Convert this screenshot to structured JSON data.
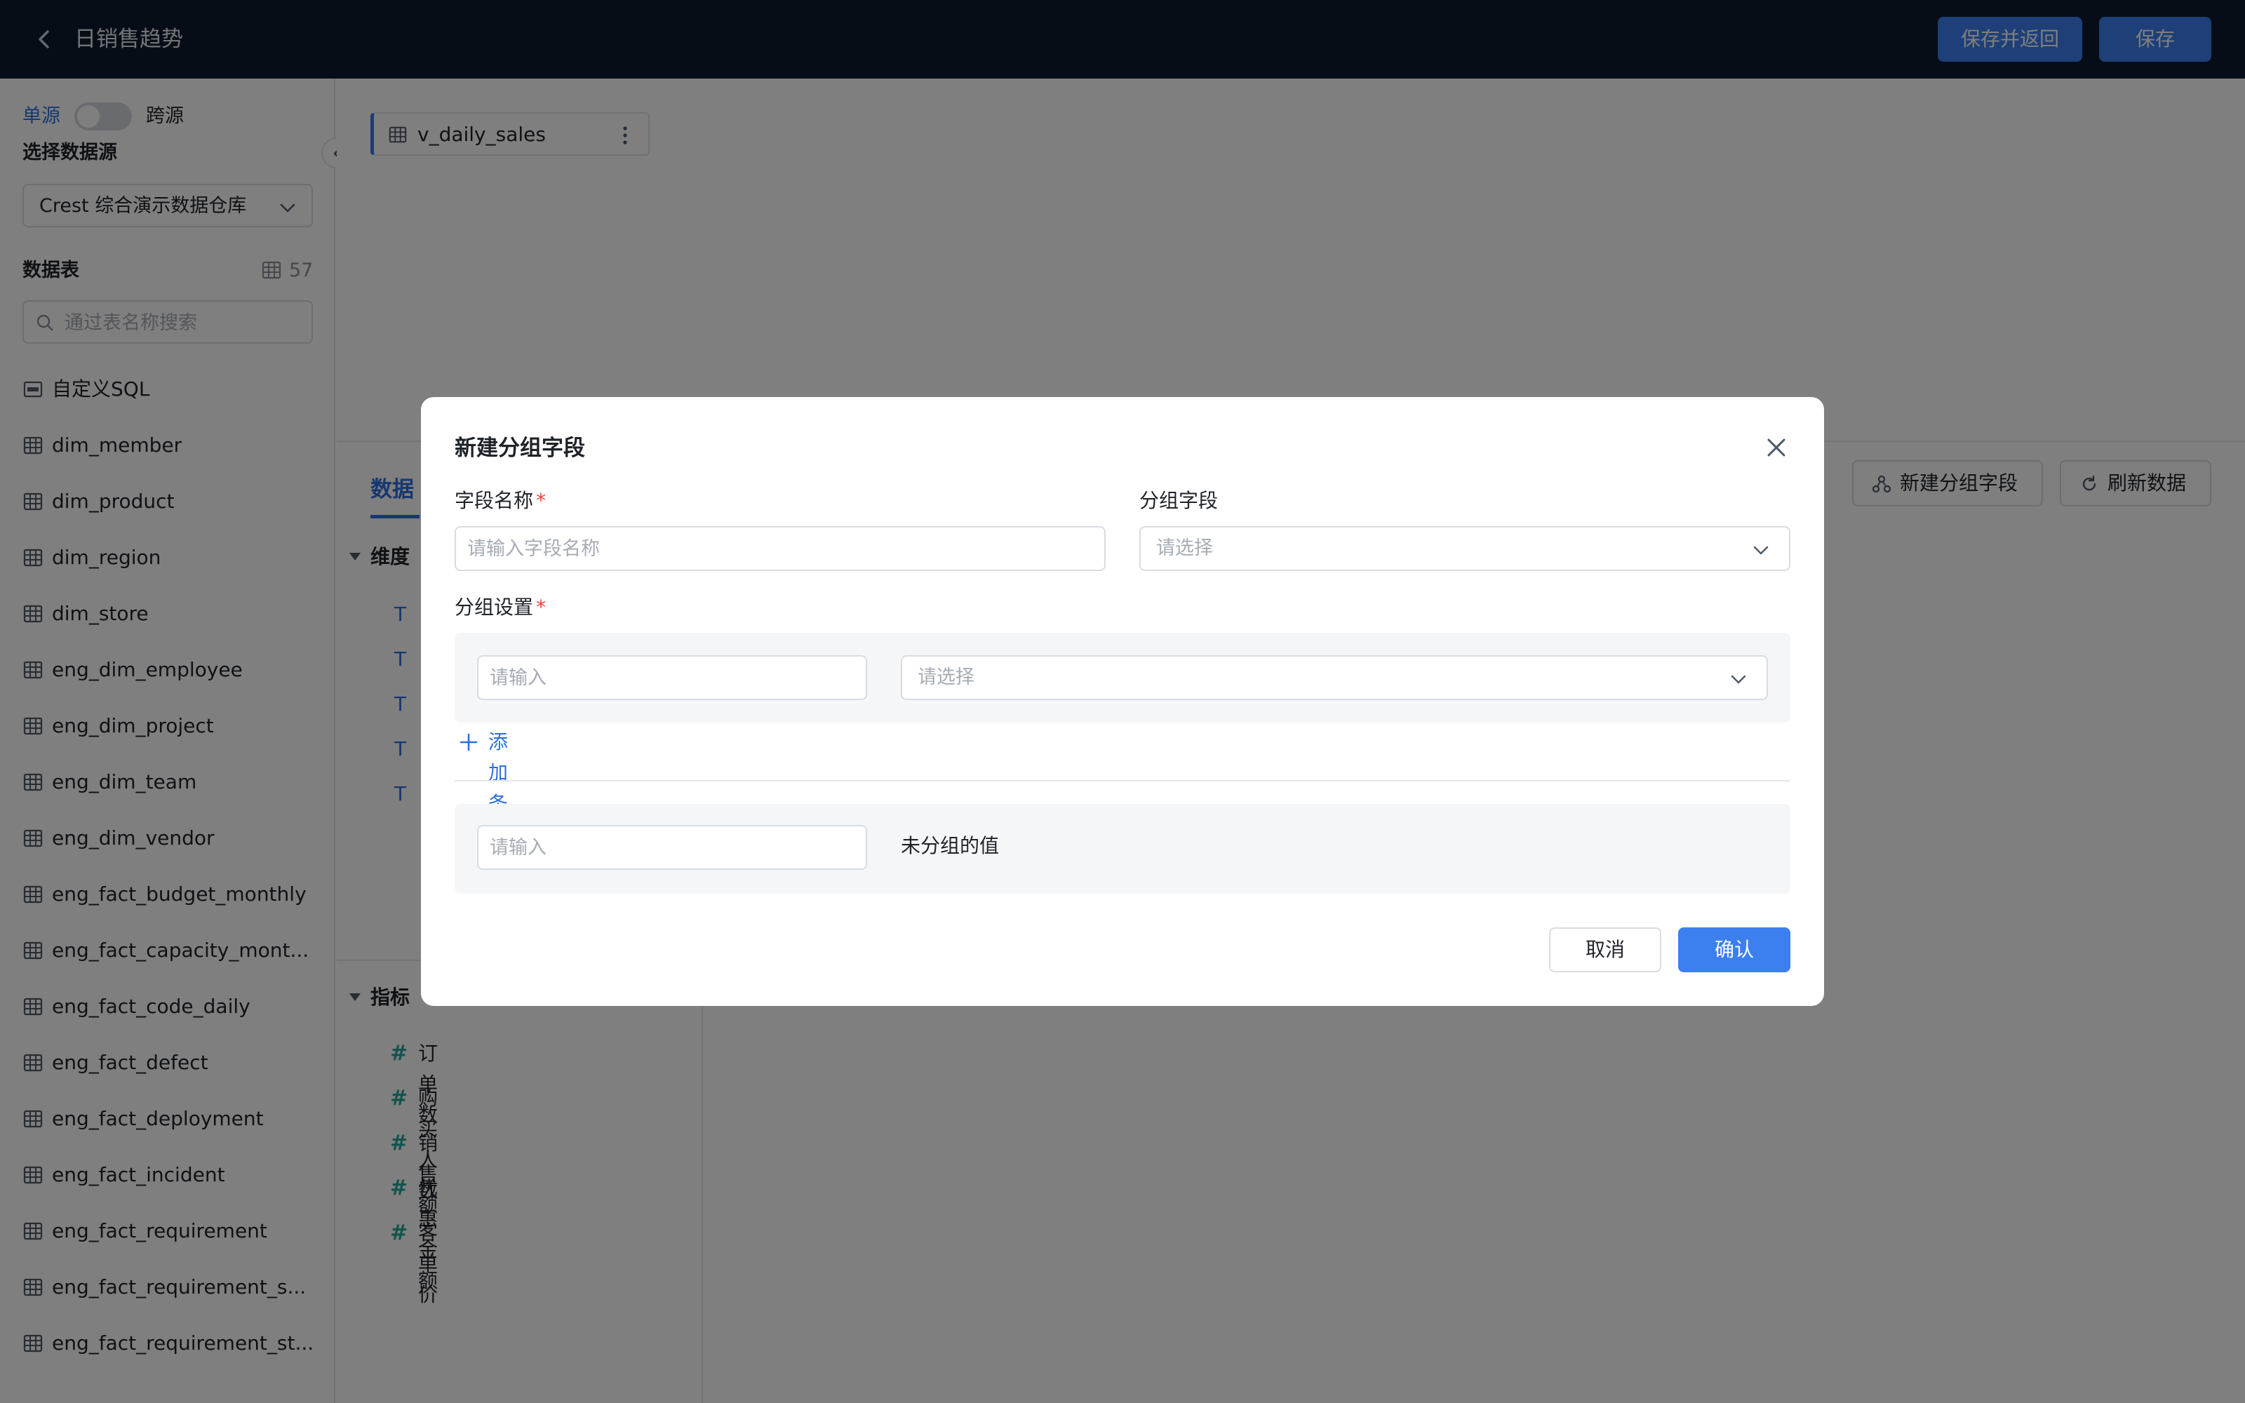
{
  "header": {
    "title": "日销售趋势",
    "save_return_label": "保存并返回",
    "save_label": "保存"
  },
  "sidebar": {
    "source_single": "单源",
    "source_cross": "跨源",
    "select_source_label": "选择数据源",
    "selected_source": "Crest 综合演示数据仓库",
    "tables_label": "数据表",
    "table_count": "57",
    "search_placeholder": "通过表名称搜索",
    "items": [
      "自定义SQL",
      "dim_member",
      "dim_product",
      "dim_region",
      "dim_store",
      "eng_dim_employee",
      "eng_dim_project",
      "eng_dim_team",
      "eng_dim_vendor",
      "eng_fact_budget_monthly",
      "eng_fact_capacity_mont...",
      "eng_fact_code_daily",
      "eng_fact_defect",
      "eng_fact_deployment",
      "eng_fact_incident",
      "eng_fact_requirement",
      "eng_fact_requirement_s...",
      "eng_fact_requirement_st..."
    ]
  },
  "canvas": {
    "dataset_name": "v_daily_sales"
  },
  "panel": {
    "tab_data": "数据",
    "new_group_field": "新建分组字段",
    "refresh_data": "刷新数据",
    "dimensions_label": "维度",
    "dimension_type_glyph": "T",
    "metrics_label": "指标",
    "metric_glyph": "#",
    "metrics": [
      "订单数",
      "购买人数",
      "销售额",
      "优惠金额",
      "客单价"
    ]
  },
  "modal": {
    "title": "新建分组字段",
    "field_name_label": "字段名称",
    "required_mark": "*",
    "field_name_placeholder": "请输入字段名称",
    "group_field_label": "分组字段",
    "select_placeholder": "请选择",
    "group_settings_label": "分组设置",
    "input_placeholder": "请输入",
    "add_condition": "添加条件",
    "ungrouped_label": "未分组的值",
    "cancel": "取消",
    "confirm": "确认"
  },
  "colors": {
    "topbar": "#0d1a2d",
    "primary": "#3c7ff1",
    "link": "#2f6fe0",
    "required": "#f53f3f",
    "metric_hash": "#26a69a"
  }
}
